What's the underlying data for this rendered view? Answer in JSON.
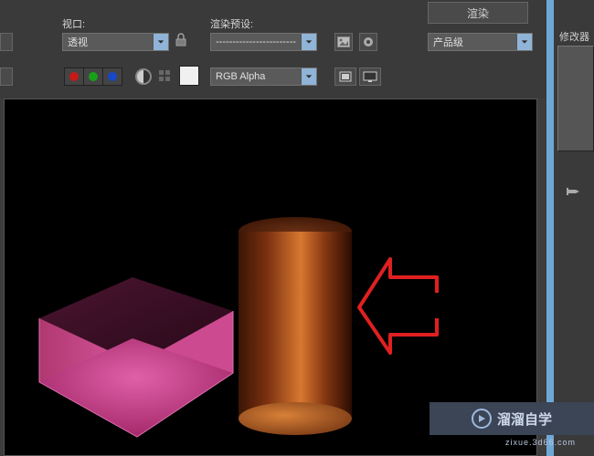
{
  "toolbar": {
    "viewport_label": "视口:",
    "preset_label": "渲染预设:",
    "render_button": "渲染",
    "viewport_dropdown": "透视",
    "preset_dropdown": "------------------------",
    "output_dropdown": "产品级",
    "channel_dropdown": "RGB Alpha",
    "swatches": [
      "#c81818",
      "#18a018",
      "#1848c8"
    ],
    "main_swatch": "#f0f0f0"
  },
  "icons": {
    "lock": "lock-icon",
    "folder": "picture-icon",
    "gear": "gear-icon",
    "circle": "contrast-icon",
    "grid": "grid-icon",
    "frame1": "window-icon",
    "frame2": "monitor-icon"
  },
  "right_panel": {
    "label": "修改器"
  },
  "render_view": {
    "objects": [
      "open-box",
      "cylinder"
    ],
    "annotation": "red-arrow-pointing-left"
  },
  "watermark": {
    "brand": "溜溜自学",
    "url": "zixue.3d66.com"
  }
}
